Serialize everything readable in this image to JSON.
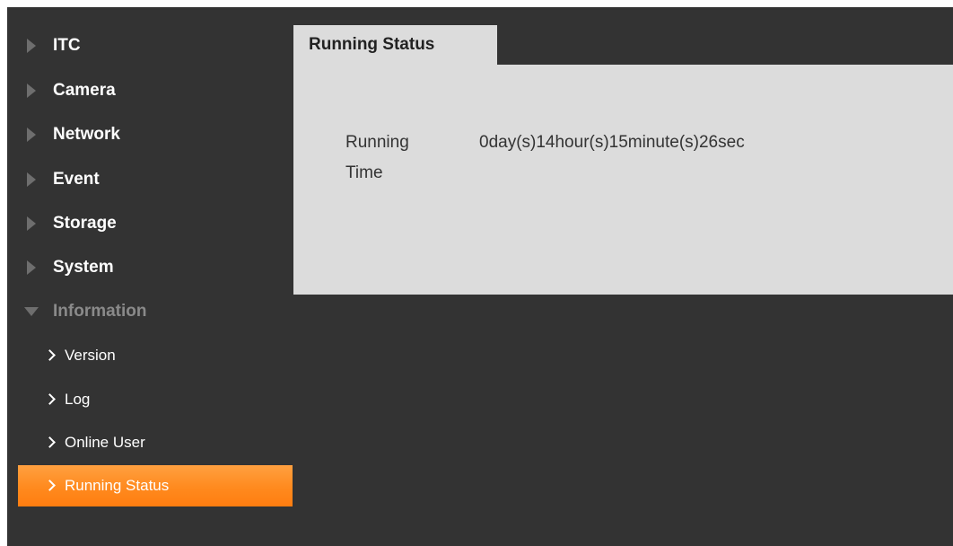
{
  "sidebar": {
    "menu": [
      {
        "label": "ITC"
      },
      {
        "label": "Camera"
      },
      {
        "label": "Network"
      },
      {
        "label": "Event"
      },
      {
        "label": "Storage"
      },
      {
        "label": "System"
      },
      {
        "label": "Information"
      }
    ],
    "submenu": [
      {
        "label": "Version"
      },
      {
        "label": "Log"
      },
      {
        "label": "Online User"
      },
      {
        "label": "Running Status"
      }
    ]
  },
  "tab": {
    "label": "Running Status"
  },
  "running_time": {
    "label_line1": "Running",
    "label_line2": "Time",
    "value": "0day(s)14hour(s)15minute(s)26sec"
  },
  "colors": {
    "background": "#333333",
    "panel": "#dcdcdc",
    "active_accent": "#ff8a1e",
    "inactive_arrow": "#6e6e6e"
  }
}
